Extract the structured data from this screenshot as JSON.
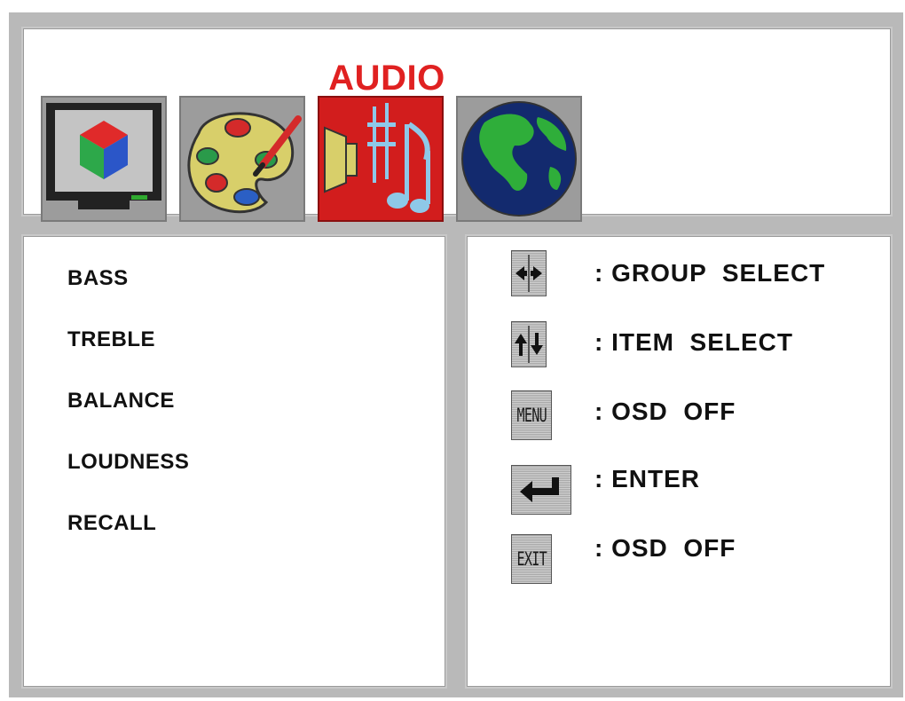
{
  "osd": {
    "groups": [
      {
        "id": "picture",
        "icon": "monitor-icon",
        "selected": false
      },
      {
        "id": "color",
        "icon": "palette-icon",
        "selected": false
      },
      {
        "id": "audio",
        "icon": "music-notes-icon",
        "selected": true
      },
      {
        "id": "language",
        "icon": "globe-icon",
        "selected": false
      }
    ],
    "selected_group_label": "AUDIO",
    "selected_color": "#e02121"
  },
  "menu": {
    "items": [
      "BASS",
      "TREBLE",
      "BALANCE",
      "LOUDNESS",
      "RECALL"
    ]
  },
  "help": {
    "rows": [
      {
        "key_icon": "left-right-arrows-icon",
        "key_text": "",
        "label": ": GROUP  SELECT"
      },
      {
        "key_icon": "up-down-arrows-icon",
        "key_text": "",
        "label": ": ITEM  SELECT"
      },
      {
        "key_icon": "menu-key-icon",
        "key_text": "MENU",
        "label": ": OSD  OFF"
      },
      {
        "key_icon": "enter-key-icon",
        "key_text": "",
        "label": ": ENTER"
      },
      {
        "key_icon": "exit-key-icon",
        "key_text": "EXIT",
        "label": ": OSD  OFF"
      }
    ]
  }
}
